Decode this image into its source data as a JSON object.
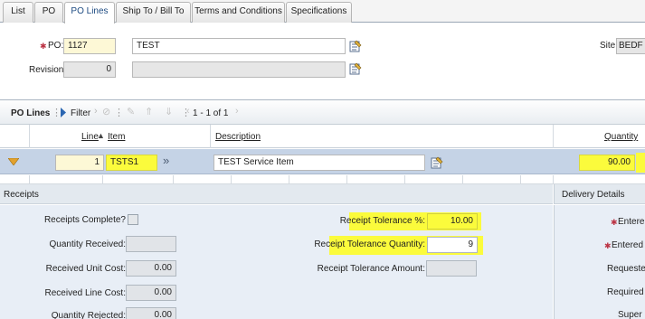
{
  "tabs": [
    {
      "label": "List"
    },
    {
      "label": "PO"
    },
    {
      "label": "PO Lines"
    },
    {
      "label": "Ship To / Bill To"
    },
    {
      "label": "Terms and Conditions"
    },
    {
      "label": "Specifications"
    }
  ],
  "active_tab": "PO Lines",
  "header": {
    "po_label": "PO:",
    "po_value": "1127",
    "po_description": "TEST",
    "revision_label": "Revision:",
    "revision_value": "0",
    "site_label": "Site:",
    "site_value": "BEDF"
  },
  "po_lines": {
    "section_title": "PO Lines",
    "filter_label": "Filter",
    "pagination": "1 - 1 of 1",
    "columns": {
      "line": "Line",
      "item": "Item",
      "description": "Description",
      "quantity": "Quantity"
    },
    "rows": [
      {
        "line": "1",
        "item": "TSTS1",
        "description": "TEST Service Item",
        "quantity": "90.00"
      }
    ]
  },
  "receipts": {
    "title": "Receipts",
    "receipts_complete_label": "Receipts Complete?",
    "quantity_received_label": "Quantity Received:",
    "received_unit_cost_label": "Received Unit Cost:",
    "received_unit_cost": "0.00",
    "received_line_cost_label": "Received Line Cost:",
    "received_line_cost": "0.00",
    "quantity_rejected_label": "Quantity Rejected:",
    "quantity_rejected": "0.00",
    "tolerance_pct_label": "Receipt Tolerance %:",
    "tolerance_pct": "10.00",
    "tolerance_qty_label": "Receipt Tolerance Quantity:",
    "tolerance_qty": "9",
    "tolerance_amount_label": "Receipt Tolerance Amount:"
  },
  "delivery": {
    "title": "Delivery Details",
    "entered_label": "Entere",
    "entered_by_label": "Entered",
    "requested_label": "Requeste",
    "required_label": "Required",
    "supervisor_label": "Super"
  },
  "colors": {
    "highlight": "#fbfb3c",
    "row_selected": "#c5d3e6",
    "section_bg": "#e8eef6",
    "tab_active_text": "#1e4b82"
  }
}
